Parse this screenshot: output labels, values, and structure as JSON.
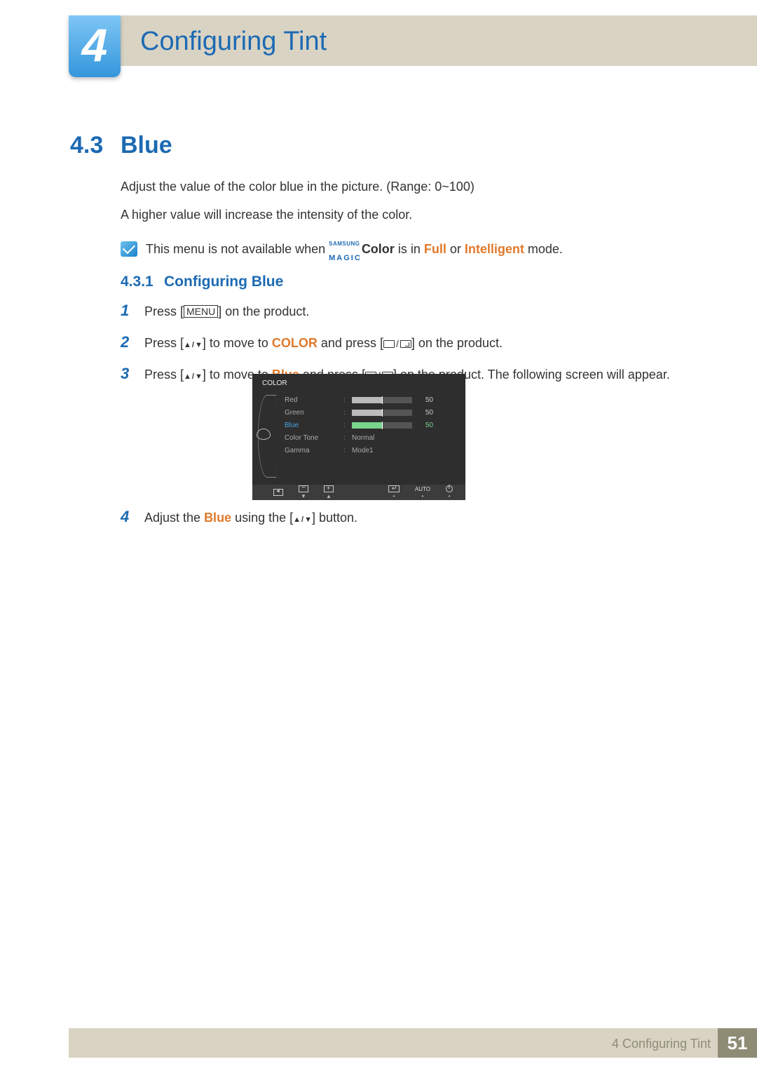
{
  "chapter": {
    "number": "4",
    "title": "Configuring Tint"
  },
  "section": {
    "number": "4.3",
    "title": "Blue"
  },
  "paragraphs": {
    "p1": "Adjust the value of the color blue in the picture. (Range: 0~100)",
    "p2": "A higher value will increase the intensity of the color."
  },
  "note": {
    "pre": "This menu is not available when ",
    "brand_top": "SAMSUNG",
    "brand_bot": "MAGIC",
    "post1": "Color",
    "post2": " is in ",
    "full": "Full",
    "post3": " or ",
    "intelligent": "Intelligent",
    "post4": " mode."
  },
  "subsection": {
    "number": "4.3.1",
    "title": "Configuring Blue"
  },
  "steps": {
    "s1n": "1",
    "s1a": "Press [",
    "s1menu": "MENU",
    "s1b": "] on the product.",
    "s2n": "2",
    "s2a": "Press [",
    "s2b": "] to move to ",
    "s2color": "COLOR",
    "s2c": " and press [",
    "s2d": "] on the product.",
    "s3n": "3",
    "s3a": "Press [",
    "s3b": "] to move to ",
    "s3blue": "Blue",
    "s3c": " and press [",
    "s3d": "] on the product. The following screen will appear.",
    "s4n": "4",
    "s4a": "Adjust the ",
    "s4blue": "Blue",
    "s4b": " using the [",
    "s4c": "] button."
  },
  "osd": {
    "title": "COLOR",
    "rows": {
      "red": {
        "label": "Red",
        "value": "50",
        "fill": 50
      },
      "green": {
        "label": "Green",
        "value": "50",
        "fill": 50
      },
      "blue": {
        "label": "Blue",
        "value": "50",
        "fill": 50
      },
      "tone": {
        "label": "Color Tone",
        "value": "Normal"
      },
      "gamma": {
        "label": "Gamma",
        "value": "Mode1"
      }
    },
    "auto": "AUTO"
  },
  "footer": {
    "label": "4 Configuring Tint",
    "page": "51"
  }
}
